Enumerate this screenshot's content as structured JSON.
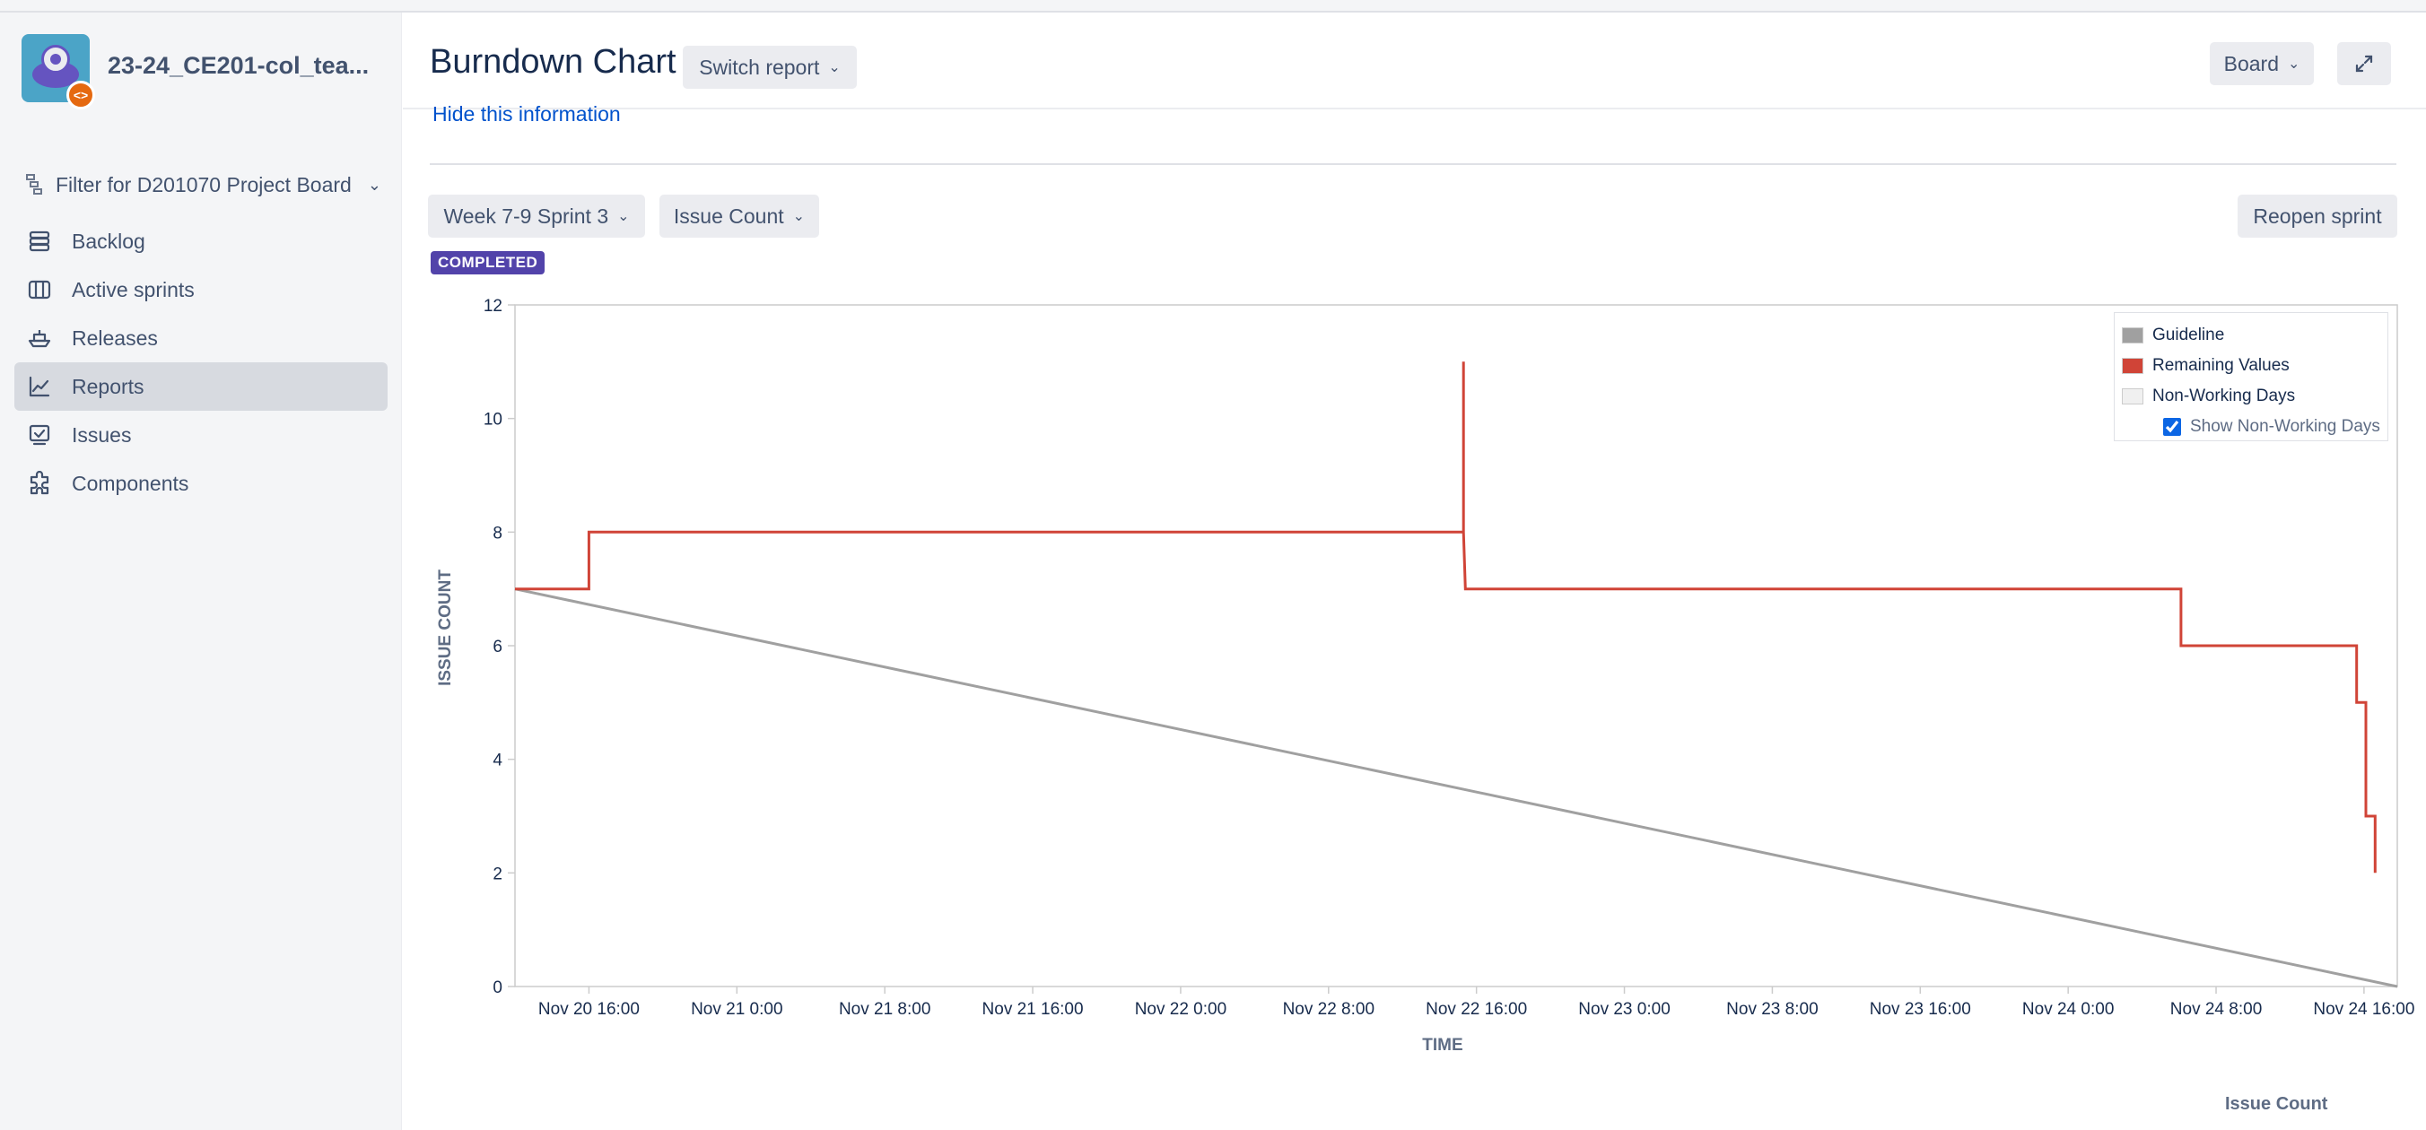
{
  "sidebar": {
    "project_name": "23-24_CE201-col_tea...",
    "board_filter": "Filter for D201070 Project Board",
    "items": [
      {
        "label": "Backlog",
        "icon": "backlog-icon"
      },
      {
        "label": "Active sprints",
        "icon": "board-icon"
      },
      {
        "label": "Releases",
        "icon": "ship-icon"
      },
      {
        "label": "Reports",
        "icon": "chart-icon",
        "active": true
      },
      {
        "label": "Issues",
        "icon": "issues-icon"
      },
      {
        "label": "Components",
        "icon": "puzzle-icon"
      }
    ]
  },
  "header": {
    "title": "Burndown Chart",
    "switch_report": "Switch report",
    "board": "Board"
  },
  "main": {
    "hide_info": "Hide this information",
    "sprint": "Week 7-9 Sprint 3",
    "metric": "Issue Count",
    "reopen": "Reopen sprint",
    "status": "COMPLETED",
    "footer_label": "Issue Count"
  },
  "legend": {
    "guideline": "Guideline",
    "remaining": "Remaining Values",
    "non_working": "Non-Working Days",
    "show_non_working": "Show Non-Working Days",
    "show_non_working_checked": true
  },
  "colors": {
    "guideline": "#a0a0a0",
    "remaining": "#d04437",
    "non_working": "#f0f0f0",
    "accent": "#5243aa"
  },
  "chart_data": {
    "type": "line",
    "xlabel": "TIME",
    "ylabel": "ISSUE COUNT",
    "ylim": [
      0,
      12
    ],
    "y_ticks": [
      "0",
      "2",
      "4",
      "6",
      "8",
      "10",
      "12"
    ],
    "x_ticks": [
      "Nov 20 16:00",
      "Nov 21 0:00",
      "Nov 21 8:00",
      "Nov 21 16:00",
      "Nov 22 0:00",
      "Nov 22 8:00",
      "Nov 22 16:00",
      "Nov 23 0:00",
      "Nov 23 8:00",
      "Nov 23 16:00",
      "Nov 24 0:00",
      "Nov 24 8:00",
      "Nov 24 16:00"
    ],
    "x_tick_hours": [
      0,
      8,
      16,
      24,
      32,
      40,
      48,
      56,
      64,
      72,
      80,
      88,
      96
    ],
    "xlim_hours": [
      -4.0,
      97.8
    ],
    "grid": false,
    "legend_position": "top-right",
    "series": [
      {
        "name": "Guideline",
        "points": [
          [
            -4.0,
            7
          ],
          [
            97.8,
            0
          ]
        ]
      },
      {
        "name": "Remaining Values",
        "points": [
          [
            -4.0,
            7
          ],
          [
            0.0,
            7
          ],
          [
            0.0,
            8
          ],
          [
            47.3,
            8
          ],
          [
            47.3,
            11
          ],
          [
            47.3,
            8
          ],
          [
            47.4,
            7
          ],
          [
            86.1,
            7
          ],
          [
            86.1,
            6
          ],
          [
            95.6,
            6
          ],
          [
            95.6,
            5
          ],
          [
            96.1,
            5
          ],
          [
            96.1,
            3
          ],
          [
            96.6,
            3
          ],
          [
            96.6,
            2
          ]
        ]
      }
    ]
  }
}
